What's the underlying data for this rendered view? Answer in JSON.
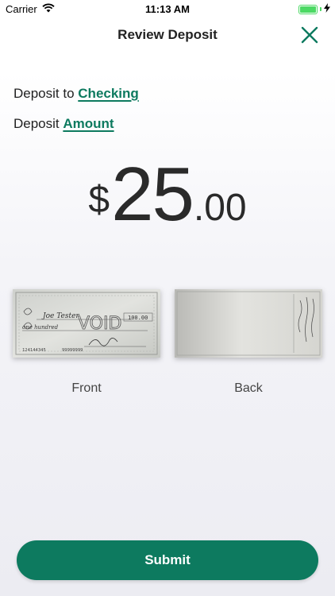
{
  "status_bar": {
    "carrier": "Carrier",
    "time": "11:13 AM",
    "battery_level": 1.0,
    "icons": [
      "wifi-icon",
      "battery-icon",
      "charging-icon"
    ]
  },
  "nav": {
    "title": "Review Deposit",
    "close_icon": "close-icon"
  },
  "deposit_to": {
    "prefix": "Deposit to",
    "account": "Checking"
  },
  "deposit_amount": {
    "prefix": "Deposit",
    "link": "Amount"
  },
  "amount": {
    "currency": "$",
    "whole": "25",
    "cents": ".00"
  },
  "check_images": {
    "front": {
      "caption": "Front",
      "void_text": "VOID",
      "payee": "Joe Tester",
      "amount_words": "one hundred",
      "amount_box": "100.00",
      "micr": "124144345",
      "account_number": "99999999"
    },
    "back": {
      "caption": "Back"
    }
  },
  "submit": {
    "label": "Submit"
  },
  "colors": {
    "accent": "#0d7a5f",
    "battery": "#4cd964"
  }
}
